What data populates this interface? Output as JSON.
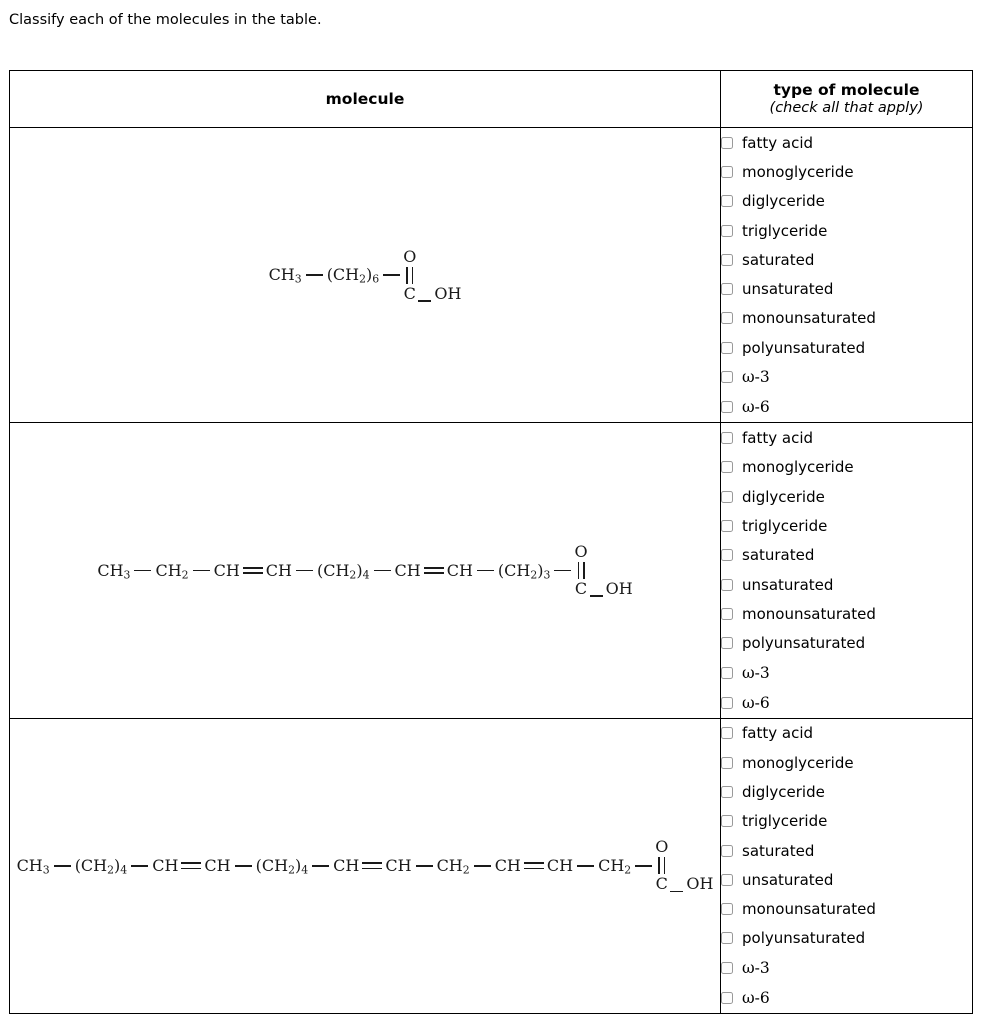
{
  "prompt": "Classify each of the molecules in the table.",
  "table": {
    "headers": {
      "molecule": "molecule",
      "type_title": "type of molecule",
      "type_subtitle": "(check all that apply)"
    },
    "options": [
      "fatty acid",
      "monoglyceride",
      "diglyceride",
      "triglyceride",
      "saturated",
      "unsaturated",
      "monounsaturated",
      "polyunsaturated",
      "ω-3",
      "ω-6"
    ],
    "rows": [
      {
        "molecule_formula": "CH3-(CH2)6-C(=O)-OH",
        "segments": [
          {
            "type": "group",
            "text": "CH",
            "sub": "3"
          },
          {
            "type": "bond"
          },
          {
            "type": "group",
            "text": "(CH",
            "sub": "2",
            "tail": ")",
            "subtail": "6"
          },
          {
            "type": "bond"
          },
          {
            "type": "carboxyl",
            "carbon": "C",
            "oxygen": "O",
            "hydroxyl": "OH"
          }
        ]
      },
      {
        "molecule_formula": "CH3-CH2-CH=CH-(CH2)4-CH=CH-(CH2)3-C(=O)-OH",
        "segments": [
          {
            "type": "group",
            "text": "CH",
            "sub": "3"
          },
          {
            "type": "bond"
          },
          {
            "type": "group",
            "text": "CH",
            "sub": "2"
          },
          {
            "type": "bond"
          },
          {
            "type": "group",
            "text": "CH"
          },
          {
            "type": "dbond"
          },
          {
            "type": "group",
            "text": "CH"
          },
          {
            "type": "bond"
          },
          {
            "type": "group",
            "text": "(CH",
            "sub": "2",
            "tail": ")",
            "subtail": "4"
          },
          {
            "type": "bond"
          },
          {
            "type": "group",
            "text": "CH"
          },
          {
            "type": "dbond"
          },
          {
            "type": "group",
            "text": "CH"
          },
          {
            "type": "bond"
          },
          {
            "type": "group",
            "text": "(CH",
            "sub": "2",
            "tail": ")",
            "subtail": "3"
          },
          {
            "type": "bond"
          },
          {
            "type": "carboxyl",
            "carbon": "C",
            "oxygen": "O",
            "hydroxyl": "OH"
          }
        ]
      },
      {
        "molecule_formula": "CH3-(CH2)4-CH=CH-(CH2)4-CH=CH-CH2-CH=CH-CH2-C(=O)-OH",
        "segments": [
          {
            "type": "group",
            "text": "CH",
            "sub": "3"
          },
          {
            "type": "bond"
          },
          {
            "type": "group",
            "text": "(CH",
            "sub": "2",
            "tail": ")",
            "subtail": "4"
          },
          {
            "type": "bond"
          },
          {
            "type": "group",
            "text": "CH"
          },
          {
            "type": "dbond"
          },
          {
            "type": "group",
            "text": "CH"
          },
          {
            "type": "bond"
          },
          {
            "type": "group",
            "text": "(CH",
            "sub": "2",
            "tail": ")",
            "subtail": "4"
          },
          {
            "type": "bond"
          },
          {
            "type": "group",
            "text": "CH"
          },
          {
            "type": "dbond"
          },
          {
            "type": "group",
            "text": "CH"
          },
          {
            "type": "bond"
          },
          {
            "type": "group",
            "text": "CH",
            "sub": "2"
          },
          {
            "type": "bond"
          },
          {
            "type": "group",
            "text": "CH"
          },
          {
            "type": "dbond"
          },
          {
            "type": "group",
            "text": "CH"
          },
          {
            "type": "bond"
          },
          {
            "type": "group",
            "text": "CH",
            "sub": "2"
          },
          {
            "type": "bond"
          },
          {
            "type": "carboxyl",
            "carbon": "C",
            "oxygen": "O",
            "hydroxyl": "OH"
          }
        ]
      }
    ]
  }
}
